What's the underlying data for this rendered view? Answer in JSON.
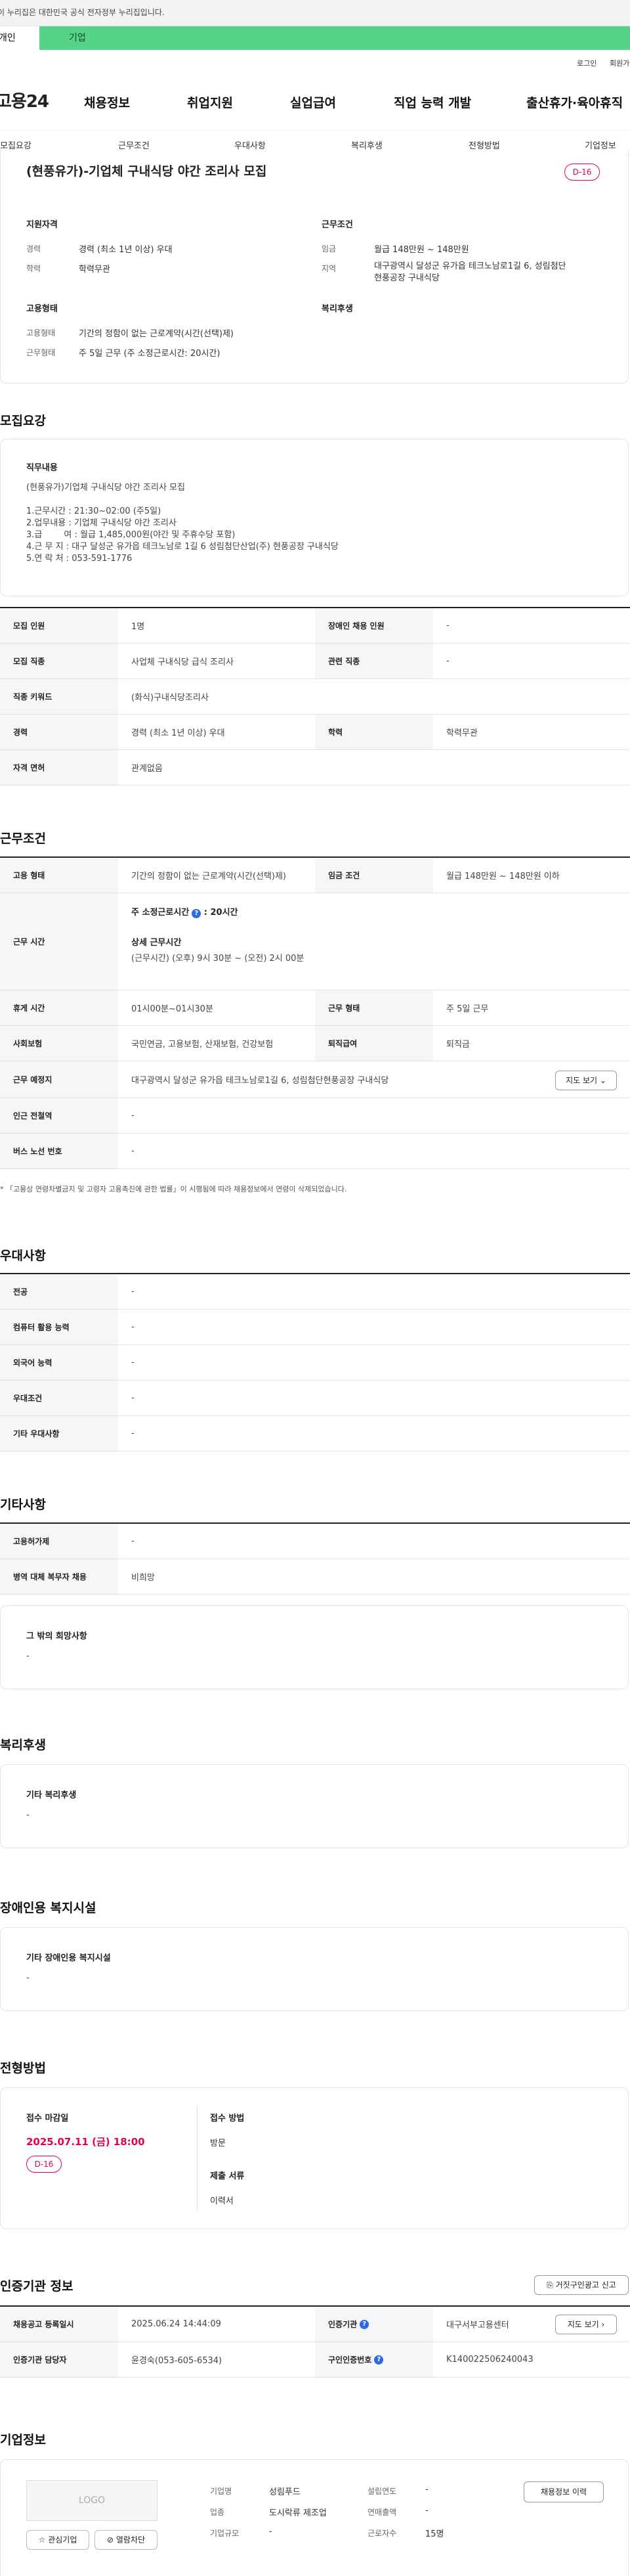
{
  "topbar": {
    "notice": "이 누리집은 대한민국 공식 전자정부 누리집입니다."
  },
  "mode_tabs": {
    "personal": "개인",
    "company": "기업"
  },
  "util": {
    "login": "로그인",
    "signup": "회원가입"
  },
  "header": {
    "logo": "고용24",
    "nav": [
      "채용정보",
      "취업지원",
      "실업급여",
      "직업 능력 개발",
      "출산휴가·육아휴직"
    ]
  },
  "subnav": [
    "모집요강",
    "근무조건",
    "우대사항",
    "복리후생",
    "전형방법",
    "기업정보"
  ],
  "summary": {
    "title": "(현풍유가)-기업체 구내식당 야간 조리사 모집",
    "dday": "D-16",
    "qual": {
      "heading": "지원자격",
      "exp_label": "경력",
      "exp": "경력 (최소 1년 이상) 우대",
      "edu_label": "학력",
      "edu": "학력무관"
    },
    "cond": {
      "heading": "근무조건",
      "wage_label": "임금",
      "wage": "월급 148만원 ~ 148만원",
      "region_label": "지역",
      "region_1": "대구광역시 달성군 유가읍 테크노남로1길 6, 성림첨단",
      "region_2": "현풍공장 구내식당"
    },
    "emp": {
      "heading": "고용형태",
      "type_label": "고용형태",
      "type": "기간의 정함이 없는 근로계약(시간(선택)제)",
      "hours_label": "근무형태",
      "hours": "주 5일 근무 (주 소정근로시간: 20시간)"
    },
    "welfare": {
      "heading": "복리후생"
    }
  },
  "recruit": {
    "heading": "모집요강",
    "duty_heading": "직무내용",
    "duty_text": "(현풍유가)기업체 구내식당 야간 조리사 모집\n\n1.근무시간 : 21:30~02:00 (주5일)\n2.업무내용 : 기업체 구내식당 야간 조리사\n3.급        여 : 월급 1,485,000원(야간 및 주휴수당 포함)\n4.근 무 지 : 대구 달성군 유가읍 테크노남로 1길 6 성림첨단산업(주) 현풍공장 구내식당\n5.연 락 처 : 053-591-1776",
    "table": {
      "count_label": "모집 인원",
      "count": "1명",
      "disabled_label": "장애인 채용 인원",
      "disabled": "-",
      "job_label": "모집 직종",
      "job": "사업체 구내식당 급식 조리사",
      "related_label": "관련 직종",
      "related": "-",
      "kw_label": "직종 키워드",
      "kw": "(화식)구내식당조리사",
      "exp_label": "경력",
      "exp": "경력 (최소 1년 이상) 우대",
      "edu_label": "학력",
      "edu": "학력무관",
      "license_label": "자격 면허",
      "license": "관계없음"
    }
  },
  "work": {
    "heading": "근무조건",
    "emp_label": "고용 형태",
    "emp": "기간의 정함이 없는 근로계약(시간(선택)제)",
    "wage_label": "임금 조건",
    "wage": "월급 148만원 ~ 148만원 이하",
    "time_label": "근무 시간",
    "weekly": "주 소정근로시간",
    "weekly_val": ": 20시간",
    "detail_label": "상세 근무시간",
    "detail": "(근무시간) (오후) 9시 30분 ~ (오전) 2시 00분",
    "rest_label": "휴게 시간",
    "rest": "01시00분~01시30분",
    "form_label": "근무 형태",
    "form": "주 5일 근무",
    "ins_label": "사회보험",
    "ins": "국민연금, 고용보험, 산재보험, 건강보험",
    "sev_label": "퇴직급여",
    "sev": "퇴직금",
    "place_label": "근무 예정지",
    "place": "대구광역시 달성군 유가읍 테크노남로1길 6, 성림첨단현풍공장 구내식당",
    "map_btn": "지도 보기",
    "station_label": "인근 전철역",
    "station": "-",
    "bus_label": "버스 노선 번호",
    "bus": "-",
    "note": "「고용상 연령차별금지 및 고령자 고용촉진에 관한 법률」이 시행됨에 따라 채용정보에서 연령이 삭제되었습니다."
  },
  "pref": {
    "heading": "우대사항",
    "rows": [
      {
        "label": "전공",
        "value": "-"
      },
      {
        "label": "컴퓨터 활용 능력",
        "value": "-"
      },
      {
        "label": "외국어 능력",
        "value": "-"
      },
      {
        "label": "우대조건",
        "value": "-"
      },
      {
        "label": "기타 우대사항",
        "value": "-"
      }
    ]
  },
  "etc": {
    "heading": "기타사항",
    "rows": [
      {
        "label": "고용허가제",
        "value": "-"
      },
      {
        "label": "병역 대체 복무자 채용",
        "value": "비희망"
      }
    ],
    "hope_heading": "그 밖의 희망사항",
    "hope": "-"
  },
  "benefit": {
    "heading": "복리후생",
    "sub": "기타 복리후생",
    "value": "-"
  },
  "facility": {
    "heading": "장애인용 복지시설",
    "sub": "기타 장애인용 복지시설",
    "value": "-"
  },
  "process": {
    "heading": "전형방법",
    "deadline_label": "접수 마감일",
    "deadline": "2025.07.11 (금) 18:00",
    "dday": "D-16",
    "method_label": "접수 방법",
    "method": "방문",
    "docs_label": "제출 서류",
    "docs": "이력서"
  },
  "cert": {
    "heading": "인증기관 정보",
    "report_btn": "거짓구인광고 신고",
    "reg_label": "채용공고 등록일시",
    "reg": "2025.06.24 14:44:09",
    "org_label": "인증기관",
    "org": "대구서부고용센터",
    "map_btn": "지도 보기",
    "staff_label": "인증기관 담당자",
    "staff": "윤경숙(053-605-6534)",
    "no_label": "구인인증번호",
    "no": "K140022506240043"
  },
  "company": {
    "heading": "기업정보",
    "logo": "LOGO",
    "fav_btn": "관심기업",
    "block_btn": "열람차단",
    "name_label": "기업명",
    "name": "성림푸드",
    "year_label": "설립연도",
    "year": "-",
    "ind_label": "업종",
    "ind": "도시락류 제조업",
    "sales_label": "연매출액",
    "sales": "-",
    "size_label": "기업규모",
    "size": "-",
    "emp_label": "근로자수",
    "emp": "15명",
    "history_btn": "채용정보 이력"
  }
}
